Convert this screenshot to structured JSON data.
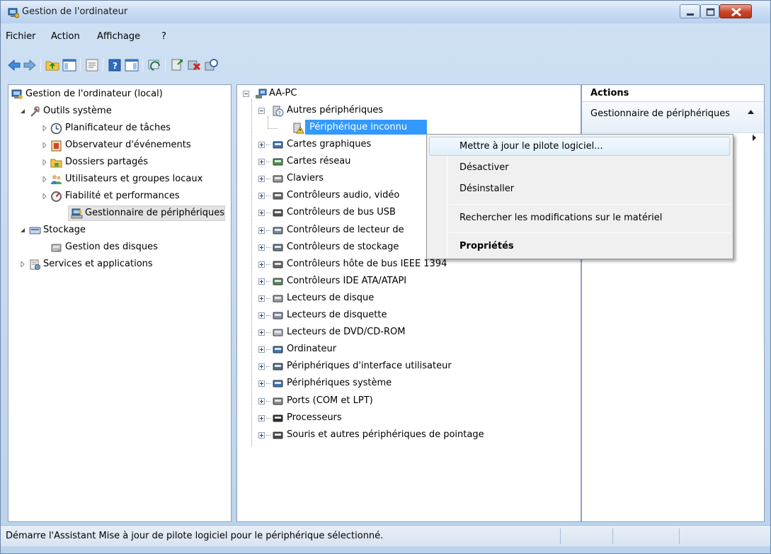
{
  "window": {
    "title": "Gestion de l'ordinateur"
  },
  "menubar": [
    "Fichier",
    "Action",
    "Affichage",
    "?"
  ],
  "toolbar_icons": [
    "back-arrow-icon",
    "forward-arrow-icon",
    "up-folder-icon",
    "show-hide-tree-icon",
    "properties-icon",
    "help-icon",
    "show-hide-action-pane-icon",
    "refresh-icon",
    "update-driver-icon",
    "uninstall-icon",
    "scan-hardware-icon"
  ],
  "left_tree": [
    {
      "label": "Gestion de l'ordinateur (local)"
    },
    {
      "label": "Outils système"
    },
    {
      "label": "Planificateur de tâches"
    },
    {
      "label": "Observateur d'événements"
    },
    {
      "label": "Dossiers partagés"
    },
    {
      "label": "Utilisateurs et groupes locaux"
    },
    {
      "label": "Fiabilité et performances"
    },
    {
      "label": "Gestionnaire de périphériques"
    },
    {
      "label": "Stockage"
    },
    {
      "label": "Gestion des disques"
    },
    {
      "label": "Services et applications"
    }
  ],
  "device_tree": {
    "root": "AA-PC",
    "expanded_group": "Autres périphériques",
    "selected_device": "Périphérique inconnu",
    "categories": [
      "Cartes graphiques",
      "Cartes réseau",
      "Claviers",
      "Contrôleurs audio, vidéo",
      "Contrôleurs de bus USB",
      "Contrôleurs de lecteur de",
      "Contrôleurs de stockage",
      "Contrôleurs hôte de bus IEEE 1394",
      "Contrôleurs IDE ATA/ATAPI",
      "Lecteurs de disque",
      "Lecteurs de disquette",
      "Lecteurs de DVD/CD-ROM",
      "Ordinateur",
      "Périphériques d'interface utilisateur",
      "Périphériques système",
      "Ports (COM et LPT)",
      "Processeurs",
      "Souris et autres périphériques de pointage"
    ]
  },
  "actions": {
    "title": "Actions",
    "section": "Gestionnaire de périphériques"
  },
  "context_menu": {
    "update_driver": "Mettre à jour le pilote logiciel...",
    "disable": "Désactiver",
    "uninstall": "Désinstaller",
    "scan": "Rechercher les modifications sur le matériel",
    "properties": "Propriétés"
  },
  "status": {
    "text": "Démarre l'Assistant Mise à jour de pilote logiciel pour le périphérique sélectionné."
  }
}
